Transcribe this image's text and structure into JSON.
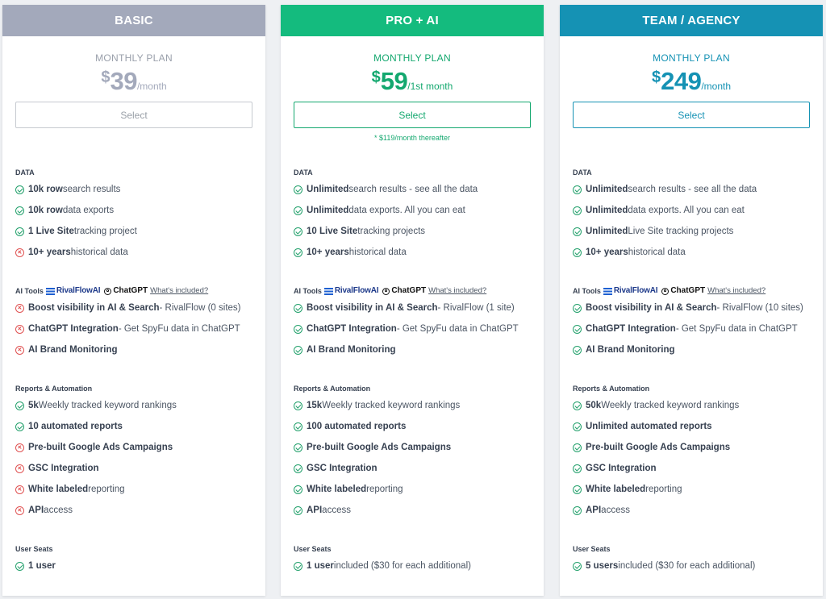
{
  "colors": {
    "basic_header": "#a3a9bb",
    "pro_header": "#14bb7e",
    "team_header": "#1592b4",
    "check": "#22a06b",
    "cross": "#e05252"
  },
  "plans": [
    {
      "name": "BASIC",
      "plan_label": "MONTHLY PLAN",
      "currency": "$",
      "price": "39",
      "period": "/month",
      "select_label": "Select",
      "note": "",
      "data_title": "DATA",
      "data": [
        {
          "icon": "check",
          "strong": "10k row",
          "text": " search results"
        },
        {
          "icon": "check",
          "strong": "10k row",
          "text": " data exports"
        },
        {
          "icon": "check",
          "strong": "1 Live Site",
          "text": " tracking project"
        },
        {
          "icon": "cross",
          "strong": "10+ years",
          "text": " historical data"
        }
      ],
      "ai_title": "AI Tools",
      "rivalflow_label": "RivalFlowAI",
      "chatgpt_label": "ChatGPT",
      "whats_included": "What's included?",
      "ai": [
        {
          "icon": "cross",
          "strong": "Boost visibility in AI & Search",
          "text": " - RivalFlow (0 sites)"
        },
        {
          "icon": "cross",
          "strong": "ChatGPT Integration",
          "text": " - Get SpyFu data in ChatGPT"
        },
        {
          "icon": "cross",
          "strong": "AI Brand Monitoring",
          "text": ""
        }
      ],
      "reports_title": "Reports & Automation",
      "reports": [
        {
          "icon": "check",
          "strong": "5k",
          "text": " Weekly tracked keyword rankings"
        },
        {
          "icon": "check",
          "strong": "10 automated reports",
          "text": ""
        },
        {
          "icon": "cross",
          "strong": "Pre-built Google Ads Campaigns",
          "text": ""
        },
        {
          "icon": "cross",
          "strong": "GSC Integration",
          "text": ""
        },
        {
          "icon": "cross",
          "strong": "White labeled",
          "text": " reporting"
        },
        {
          "icon": "cross",
          "strong": "API",
          "text": " access"
        }
      ],
      "seats_title": "User Seats",
      "seats": [
        {
          "icon": "check",
          "strong": "1 user",
          "text": ""
        }
      ]
    },
    {
      "name": "PRO + AI",
      "plan_label": "MONTHLY PLAN",
      "currency": "$",
      "price": "59",
      "period": "/1st month",
      "select_label": "Select",
      "note": "* $119/month thereafter",
      "data_title": "DATA",
      "data": [
        {
          "icon": "check",
          "strong": "Unlimited",
          "text": " search results - see all the data"
        },
        {
          "icon": "check",
          "strong": "Unlimited",
          "text": " data exports. All you can eat"
        },
        {
          "icon": "check",
          "strong": "10 Live Site",
          "text": " tracking projects"
        },
        {
          "icon": "check",
          "strong": "10+ years",
          "text": " historical data"
        }
      ],
      "ai_title": "AI Tools",
      "rivalflow_label": "RivalFlowAI",
      "chatgpt_label": "ChatGPT",
      "whats_included": "What's included?",
      "ai": [
        {
          "icon": "check",
          "strong": "Boost visibility in AI & Search",
          "text": " - RivalFlow (1 site)"
        },
        {
          "icon": "check",
          "strong": "ChatGPT Integration",
          "text": " - Get SpyFu data in ChatGPT"
        },
        {
          "icon": "check",
          "strong": "AI Brand Monitoring",
          "text": ""
        }
      ],
      "reports_title": "Reports & Automation",
      "reports": [
        {
          "icon": "check",
          "strong": "15k",
          "text": " Weekly tracked keyword rankings"
        },
        {
          "icon": "check",
          "strong": "100 automated reports",
          "text": ""
        },
        {
          "icon": "check",
          "strong": "Pre-built Google Ads Campaigns",
          "text": ""
        },
        {
          "icon": "check",
          "strong": "GSC Integration",
          "text": ""
        },
        {
          "icon": "check",
          "strong": "White labeled",
          "text": " reporting"
        },
        {
          "icon": "check",
          "strong": "API",
          "text": " access"
        }
      ],
      "seats_title": "User Seats",
      "seats": [
        {
          "icon": "check",
          "strong": "1 user",
          "text": " included ($30 for each additional)"
        }
      ]
    },
    {
      "name": "TEAM / AGENCY",
      "plan_label": "MONTHLY PLAN",
      "currency": "$",
      "price": "249",
      "period": "/month",
      "select_label": "Select",
      "note": "",
      "data_title": "DATA",
      "data": [
        {
          "icon": "check",
          "strong": "Unlimited",
          "text": " search results - see all the data"
        },
        {
          "icon": "check",
          "strong": "Unlimited",
          "text": " data exports. All you can eat"
        },
        {
          "icon": "check",
          "strong": "Unlimited",
          "text": " Live Site tracking projects"
        },
        {
          "icon": "check",
          "strong": "10+ years",
          "text": " historical data"
        }
      ],
      "ai_title": "AI Tools",
      "rivalflow_label": "RivalFlowAI",
      "chatgpt_label": "ChatGPT",
      "whats_included": "What's included?",
      "ai": [
        {
          "icon": "check",
          "strong": "Boost visibility in AI & Search",
          "text": " - RivalFlow (10 sites)"
        },
        {
          "icon": "check",
          "strong": "ChatGPT Integration",
          "text": " - Get SpyFu data in ChatGPT"
        },
        {
          "icon": "check",
          "strong": "AI Brand Monitoring",
          "text": ""
        }
      ],
      "reports_title": "Reports & Automation",
      "reports": [
        {
          "icon": "check",
          "strong": "50k",
          "text": " Weekly tracked keyword rankings"
        },
        {
          "icon": "check",
          "strong": "Unlimited automated reports",
          "text": ""
        },
        {
          "icon": "check",
          "strong": "Pre-built Google Ads Campaigns",
          "text": ""
        },
        {
          "icon": "check",
          "strong": "GSC Integration",
          "text": ""
        },
        {
          "icon": "check",
          "strong": "White labeled",
          "text": " reporting"
        },
        {
          "icon": "check",
          "strong": "API",
          "text": " access"
        }
      ],
      "seats_title": "User Seats",
      "seats": [
        {
          "icon": "check",
          "strong": "5 users",
          "text": " included ($30 for each additional)"
        }
      ]
    }
  ]
}
